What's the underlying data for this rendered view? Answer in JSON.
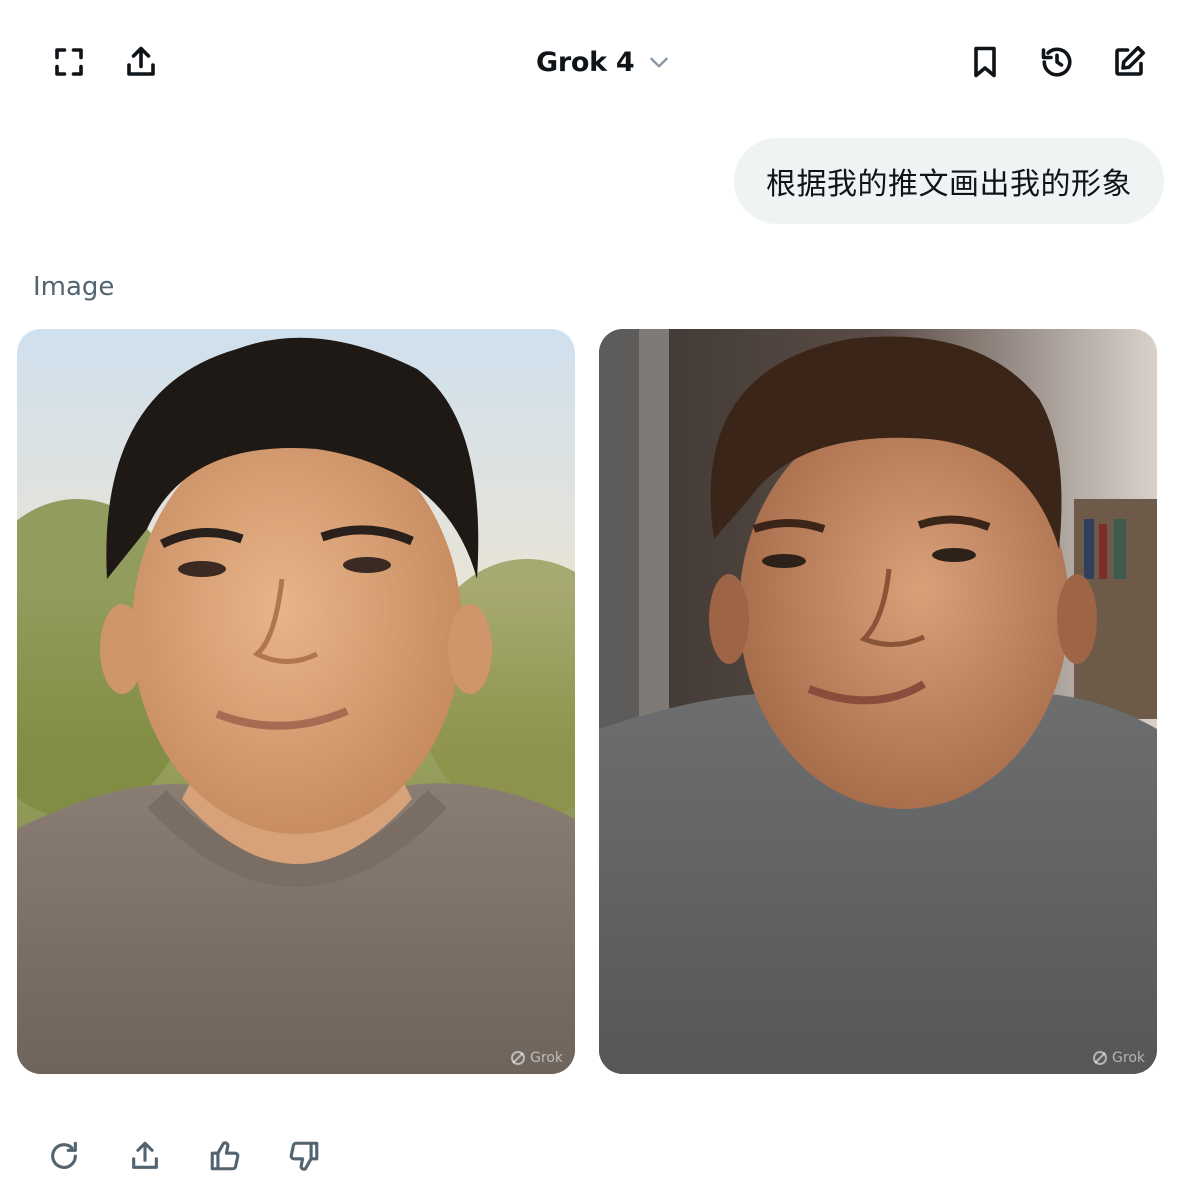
{
  "header": {
    "model_label": "Grok 4",
    "icons": {
      "fullscreen": "fullscreen-icon",
      "share": "share-icon",
      "model_dropdown": "chevron-down-icon",
      "bookmark": "bookmark-icon",
      "history": "history-icon",
      "new_chat": "edit-icon"
    }
  },
  "conversation": {
    "user_message": "根据我的推文画出我的形象",
    "response_label": "Image",
    "images": [
      {
        "watermark": "Grok"
      },
      {
        "watermark": "Grok"
      }
    ]
  },
  "actions": {
    "icons": [
      "regenerate-icon",
      "share-icon",
      "thumbs-up-icon",
      "thumbs-down-icon"
    ]
  },
  "colors": {
    "text_primary": "#0f1419",
    "text_secondary": "#536471",
    "bubble_bg": "#eff3f4",
    "chevron": "#8b98a5"
  }
}
